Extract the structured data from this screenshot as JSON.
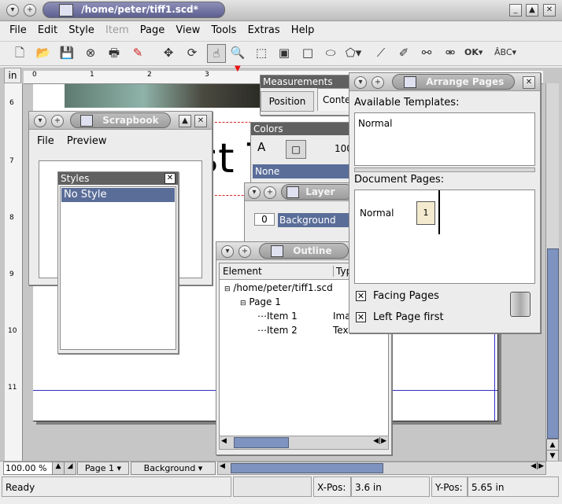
{
  "window": {
    "title": "/home/peter/tiff1.scd*"
  },
  "menubar": [
    "File",
    "Edit",
    "Style",
    "Item",
    "Page",
    "View",
    "Tools",
    "Extras",
    "Help"
  ],
  "ruler": {
    "unit": "in",
    "htick": [
      "0",
      "1",
      "2",
      "3"
    ],
    "vtick": [
      "6",
      "7",
      "8",
      "9",
      "10",
      "11"
    ]
  },
  "canvas_text": "st T",
  "measurements": {
    "title": "Measurements",
    "tabs": [
      "Position",
      "Conte"
    ]
  },
  "colors": {
    "title": "Colors",
    "value": "100",
    "selected": "None"
  },
  "layers": {
    "title": "Layer",
    "num": "0",
    "name": "Background"
  },
  "scrapbook": {
    "title": "Scrapbook",
    "menu": [
      "File",
      "Preview"
    ]
  },
  "styles": {
    "title": "Styles",
    "items": [
      "No Style"
    ]
  },
  "outline": {
    "title": "Outline",
    "cols": [
      "Element",
      "Typ"
    ],
    "rows": [
      {
        "label": "/home/peter/tiff1.scd",
        "type": ""
      },
      {
        "label": "Page 1",
        "type": ""
      },
      {
        "label": "Item 1",
        "type": "Ima"
      },
      {
        "label": "Item 2",
        "type": "Tex"
      }
    ]
  },
  "arrange": {
    "title": "Arrange Pages",
    "templates_label": "Available Templates:",
    "template": "Normal",
    "doc_label": "Document Pages:",
    "doc_template": "Normal",
    "page_num": "1",
    "facing": "Facing Pages",
    "leftfirst": "Left Page first"
  },
  "bottombar": {
    "zoom": "100.00 %",
    "page": "Page 1",
    "layer": "Background"
  },
  "status": {
    "ready": "Ready",
    "xlabel": "X-Pos:",
    "xval": "3.6 in",
    "ylabel": "Y-Pos:",
    "yval": "5.65 in"
  },
  "colors_theme": {
    "accent": "#5d608f",
    "highlight": "#5a6d99"
  }
}
